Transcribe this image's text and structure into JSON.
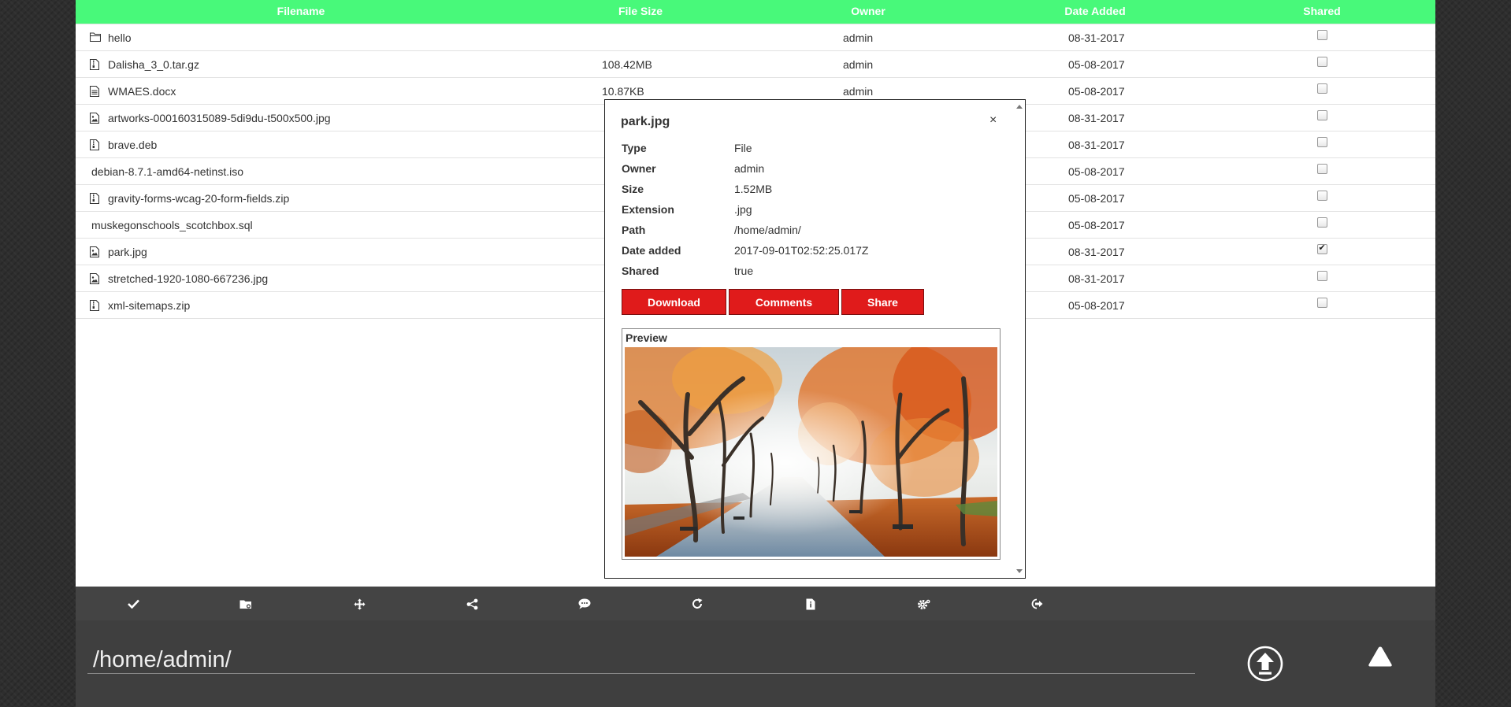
{
  "table": {
    "headers": [
      "Filename",
      "File Size",
      "Owner",
      "Date Added",
      "Shared"
    ],
    "rows": [
      {
        "name": "hello",
        "size": "",
        "owner": "admin",
        "date": "08-31-2017",
        "shared": false,
        "icon": "folder-icon"
      },
      {
        "name": "Dalisha_3_0.tar.gz",
        "size": "108.42MB",
        "owner": "admin",
        "date": "05-08-2017",
        "shared": false,
        "icon": "archive-file-icon"
      },
      {
        "name": "WMAES.docx",
        "size": "10.87KB",
        "owner": "admin",
        "date": "05-08-2017",
        "shared": false,
        "icon": "document-file-icon"
      },
      {
        "name": "artworks-000160315089-5di9du-t500x500.jpg",
        "size": "",
        "owner": "",
        "date": "08-31-2017",
        "shared": false,
        "icon": "image-file-icon"
      },
      {
        "name": "brave.deb",
        "size": "",
        "owner": "",
        "date": "08-31-2017",
        "shared": false,
        "icon": "archive-file-icon"
      },
      {
        "name": "debian-8.7.1-amd64-netinst.iso",
        "size": "",
        "owner": "",
        "date": "05-08-2017",
        "shared": false,
        "icon": ""
      },
      {
        "name": "gravity-forms-wcag-20-form-fields.zip",
        "size": "",
        "owner": "",
        "date": "05-08-2017",
        "shared": false,
        "icon": "archive-file-icon"
      },
      {
        "name": "muskegonschools_scotchbox.sql",
        "size": "",
        "owner": "",
        "date": "05-08-2017",
        "shared": false,
        "icon": ""
      },
      {
        "name": "park.jpg",
        "size": "",
        "owner": "",
        "date": "08-31-2017",
        "shared": true,
        "icon": "image-file-icon"
      },
      {
        "name": "stretched-1920-1080-667236.jpg",
        "size": "",
        "owner": "",
        "date": "08-31-2017",
        "shared": false,
        "icon": "image-file-icon"
      },
      {
        "name": "xml-sitemaps.zip",
        "size": "",
        "owner": "",
        "date": "05-08-2017",
        "shared": false,
        "icon": "archive-file-icon"
      }
    ]
  },
  "modal": {
    "title": "park.jpg",
    "close": "×",
    "properties": [
      {
        "key": "Type",
        "value": "File"
      },
      {
        "key": "Owner",
        "value": "admin"
      },
      {
        "key": "Size",
        "value": "1.52MB"
      },
      {
        "key": "Extension",
        "value": ".jpg"
      },
      {
        "key": "Path",
        "value": "/home/admin/"
      },
      {
        "key": "Date added",
        "value": "2017-09-01T02:52:25.017Z"
      },
      {
        "key": "Shared",
        "value": "true"
      }
    ],
    "actions": [
      "Download",
      "Comments",
      "Share"
    ],
    "preview_label": "Preview"
  },
  "toolbar": {
    "icons": [
      "check-icon",
      "new-folder-icon",
      "move-icon",
      "share-icon",
      "comment-icon",
      "redo-icon",
      "file-info-icon",
      "settings-icon",
      "logout-icon"
    ]
  },
  "pathbar": {
    "path": "/home/admin/"
  },
  "colors": {
    "header_green": "#48f97a",
    "action_red": "#e01b1b",
    "toolbar_gray": "#444444",
    "pathbar_gray": "#3f3f3f"
  }
}
